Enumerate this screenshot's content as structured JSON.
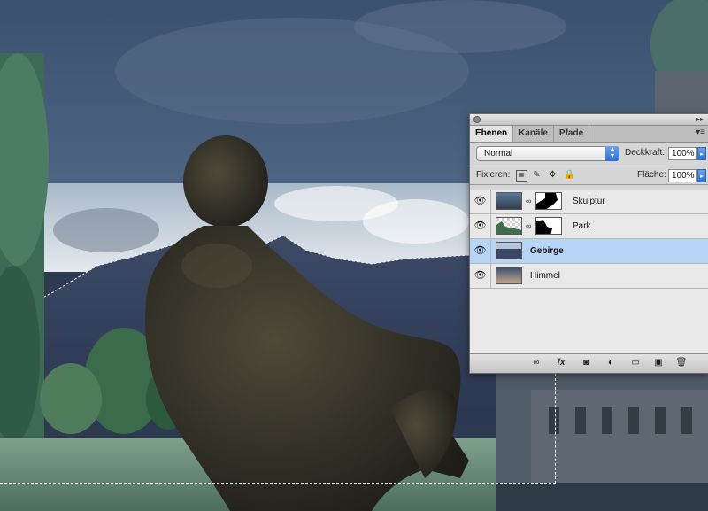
{
  "panel": {
    "tabs": [
      {
        "label": "Ebenen"
      },
      {
        "label": "Kanäle"
      },
      {
        "label": "Pfade"
      }
    ],
    "blend_mode": "Normal",
    "opacity_label": "Deckkraft:",
    "opacity_value": "100%",
    "lock_label": "Fixieren:",
    "fill_label": "Fläche:",
    "fill_value": "100%",
    "layers": [
      {
        "name": "Skulptur",
        "has_mask": true,
        "selected": false
      },
      {
        "name": "Park",
        "has_mask": true,
        "selected": false
      },
      {
        "name": "Gebirge",
        "has_mask": false,
        "selected": true
      },
      {
        "name": "Himmel",
        "has_mask": false,
        "selected": false
      }
    ],
    "bottom_icons": [
      "link-layers-icon",
      "fx-icon",
      "add-mask-icon",
      "adjustment-layer-icon",
      "new-group-icon",
      "new-layer-icon",
      "trash-icon"
    ],
    "fx_label": "fx"
  },
  "colors": {
    "selection": "#b7d5f7",
    "panel_bg": "#d6d6d6"
  }
}
